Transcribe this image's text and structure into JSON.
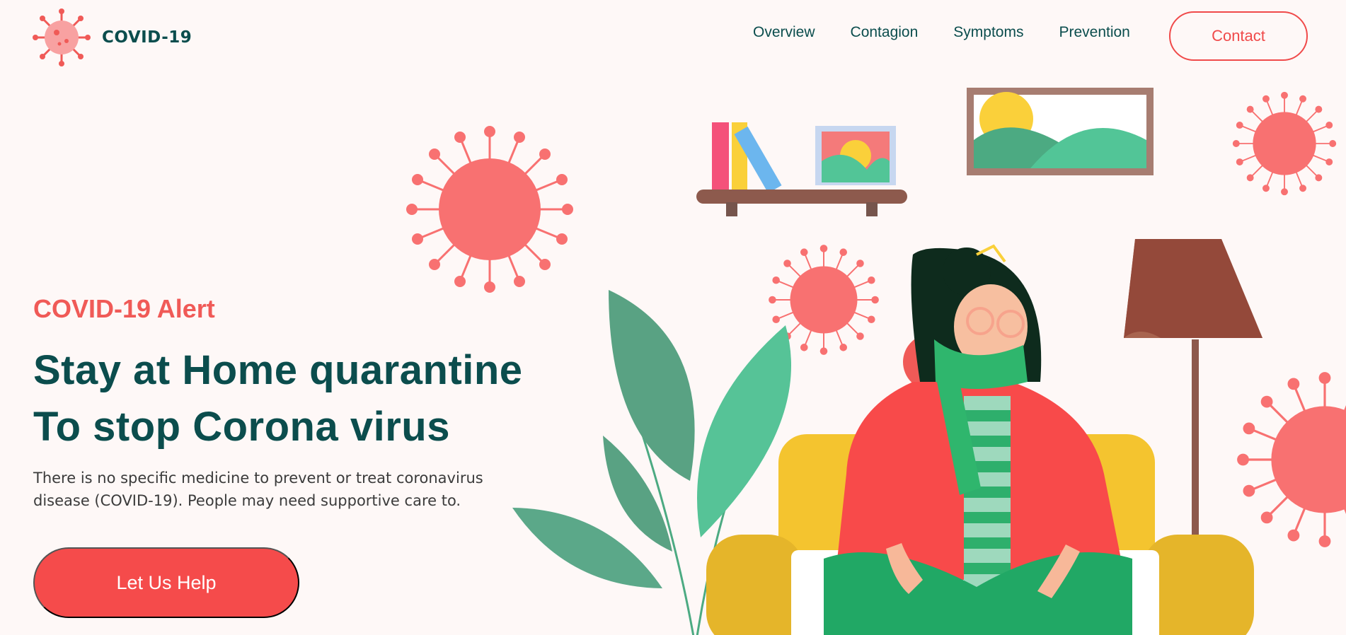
{
  "brand": {
    "name": "COVID-19",
    "icon": "virus-icon"
  },
  "nav": {
    "items": [
      {
        "label": "Overview"
      },
      {
        "label": "Contagion"
      },
      {
        "label": "Symptoms"
      },
      {
        "label": "Prevention"
      }
    ],
    "contact_label": "Contact"
  },
  "hero": {
    "alert": "COVID-19 Alert",
    "headline_line1": "Stay at Home quarantine",
    "headline_line2": "To stop Corona virus",
    "description": "There is no specific medicine to prevent or treat coronavirus disease (COVID-19). People may need supportive care to.",
    "cta_label": "Let Us Help"
  },
  "colors": {
    "primary": "#0b4d4d",
    "accent": "#f54b4b",
    "background": "#fef8f7",
    "virus": "#f87171"
  },
  "illustration": {
    "icon": "stay-home-illustration"
  }
}
